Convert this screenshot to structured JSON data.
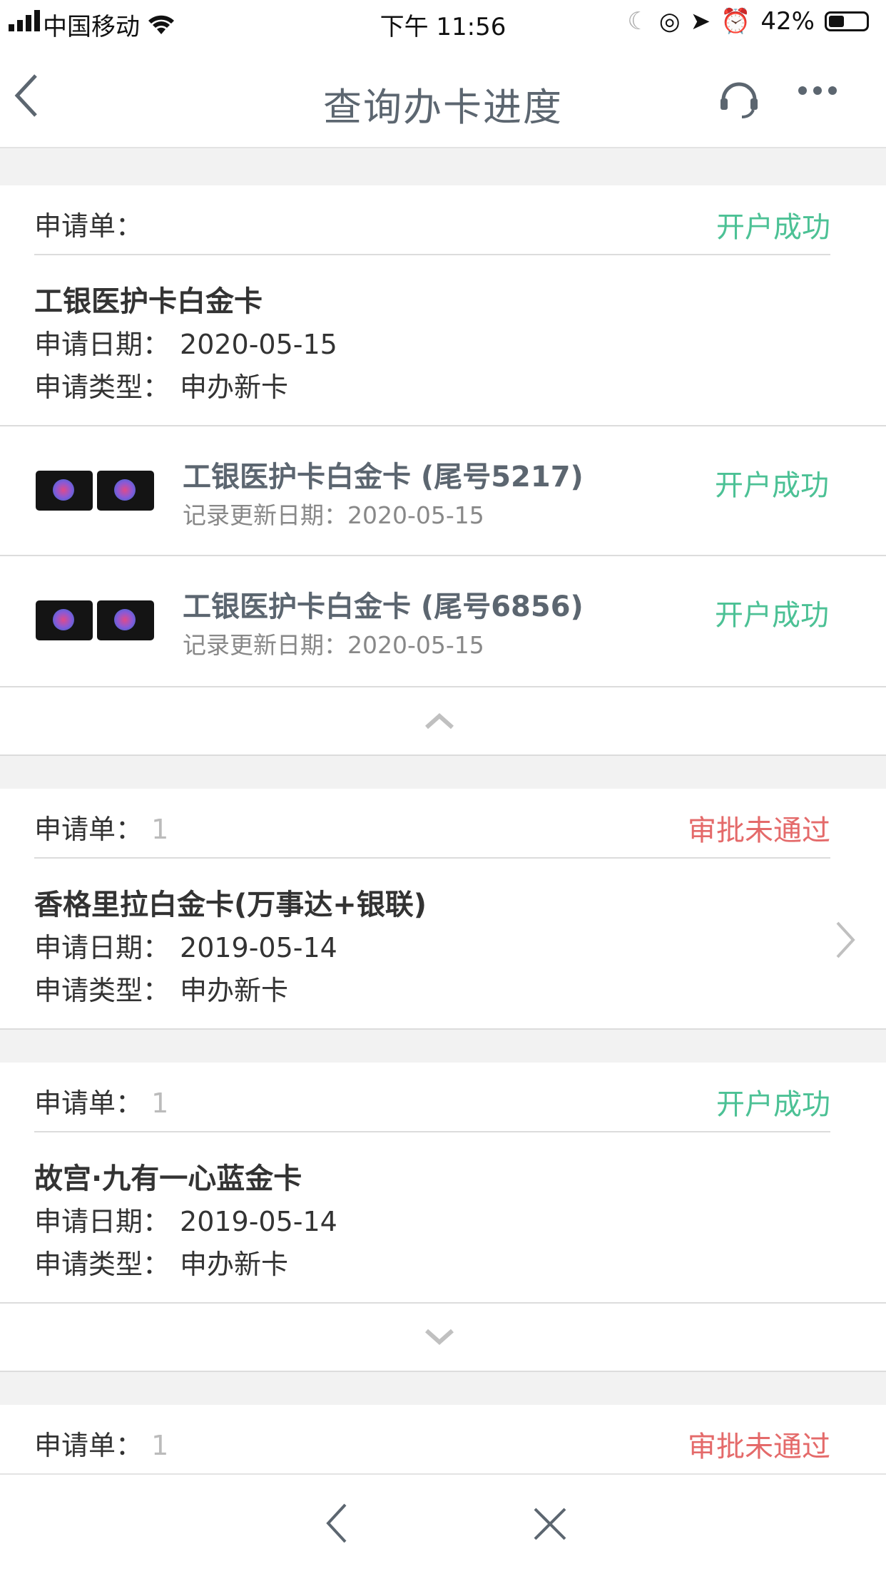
{
  "status_bar": {
    "carrier": "中国移动",
    "time": "下午 11:56",
    "battery": "42%",
    "battery_level": 0.42
  },
  "nav": {
    "back_icon": "chevron-left-icon",
    "title": "查询办卡进度",
    "service_icon": "headset-icon",
    "more_icon": "more-dots-icon"
  },
  "applications": [
    {
      "label": "申请单：",
      "status": "开户成功",
      "card_name": "工银医护卡白金卡",
      "date_label": "申请日期：",
      "date": "2020-05-15",
      "type_label": "申请类型：",
      "type": "申办新卡",
      "sub_cards": [
        {
          "title": "工银医护卡白金卡 (尾号5217)",
          "update_label": "记录更新日期：",
          "update_date": "2020-05-15",
          "status": "开户成功"
        },
        {
          "title": "工银医护卡白金卡 (尾号6856)",
          "update_label": "记录更新日期：",
          "update_date": "2020-05-15",
          "status": "开户成功"
        }
      ]
    },
    {
      "label": "申请单：",
      "number_partial": "1",
      "status": "审批未通过",
      "card_name": "香格里拉白金卡(万事达+银联)",
      "date_label": "申请日期：",
      "date": "2019-05-14",
      "type_label": "申请类型：",
      "type": "申办新卡"
    },
    {
      "label": "申请单：",
      "number_partial": "1",
      "status": "开户成功",
      "card_name": "故宫·九有一心蓝金卡",
      "date_label": "申请日期：",
      "date": "2019-05-14",
      "type_label": "申请类型：",
      "type": "申办新卡"
    },
    {
      "label": "申请单：",
      "number_partial": "1",
      "status": "审批未通过"
    }
  ],
  "bottom_bar": {
    "back_icon": "chevron-left-icon",
    "close_icon": "close-icon"
  },
  "colors": {
    "success": "#4cc195",
    "fail": "#e46a6a",
    "title": "#5c6670"
  }
}
